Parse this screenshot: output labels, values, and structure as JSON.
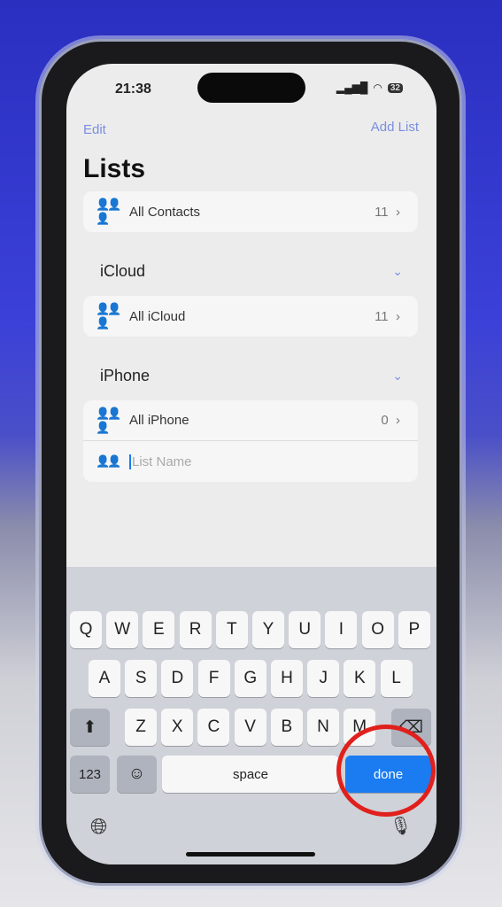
{
  "status": {
    "time": "21:38",
    "battery": "32"
  },
  "nav": {
    "edit": "Edit",
    "add_list": "Add List"
  },
  "title": "Lists",
  "all_contacts": {
    "label": "All Contacts",
    "count": "11"
  },
  "sections": [
    {
      "header": "iCloud",
      "rows": [
        {
          "label": "All iCloud",
          "count": "11"
        }
      ]
    },
    {
      "header": "iPhone",
      "rows": [
        {
          "label": "All iPhone",
          "count": "0"
        }
      ],
      "input_placeholder": "List Name"
    }
  ],
  "keyboard": {
    "row1": [
      "Q",
      "W",
      "E",
      "R",
      "T",
      "Y",
      "U",
      "I",
      "O",
      "P"
    ],
    "row2": [
      "A",
      "S",
      "D",
      "F",
      "G",
      "H",
      "J",
      "K",
      "L"
    ],
    "row3": [
      "Z",
      "X",
      "C",
      "V",
      "B",
      "N",
      "M"
    ],
    "numbers": "123",
    "space": "space",
    "done": "done"
  },
  "colors": {
    "accent": "#7a8ee0",
    "done": "#1a7cf0",
    "annotation": "#e0201c"
  }
}
